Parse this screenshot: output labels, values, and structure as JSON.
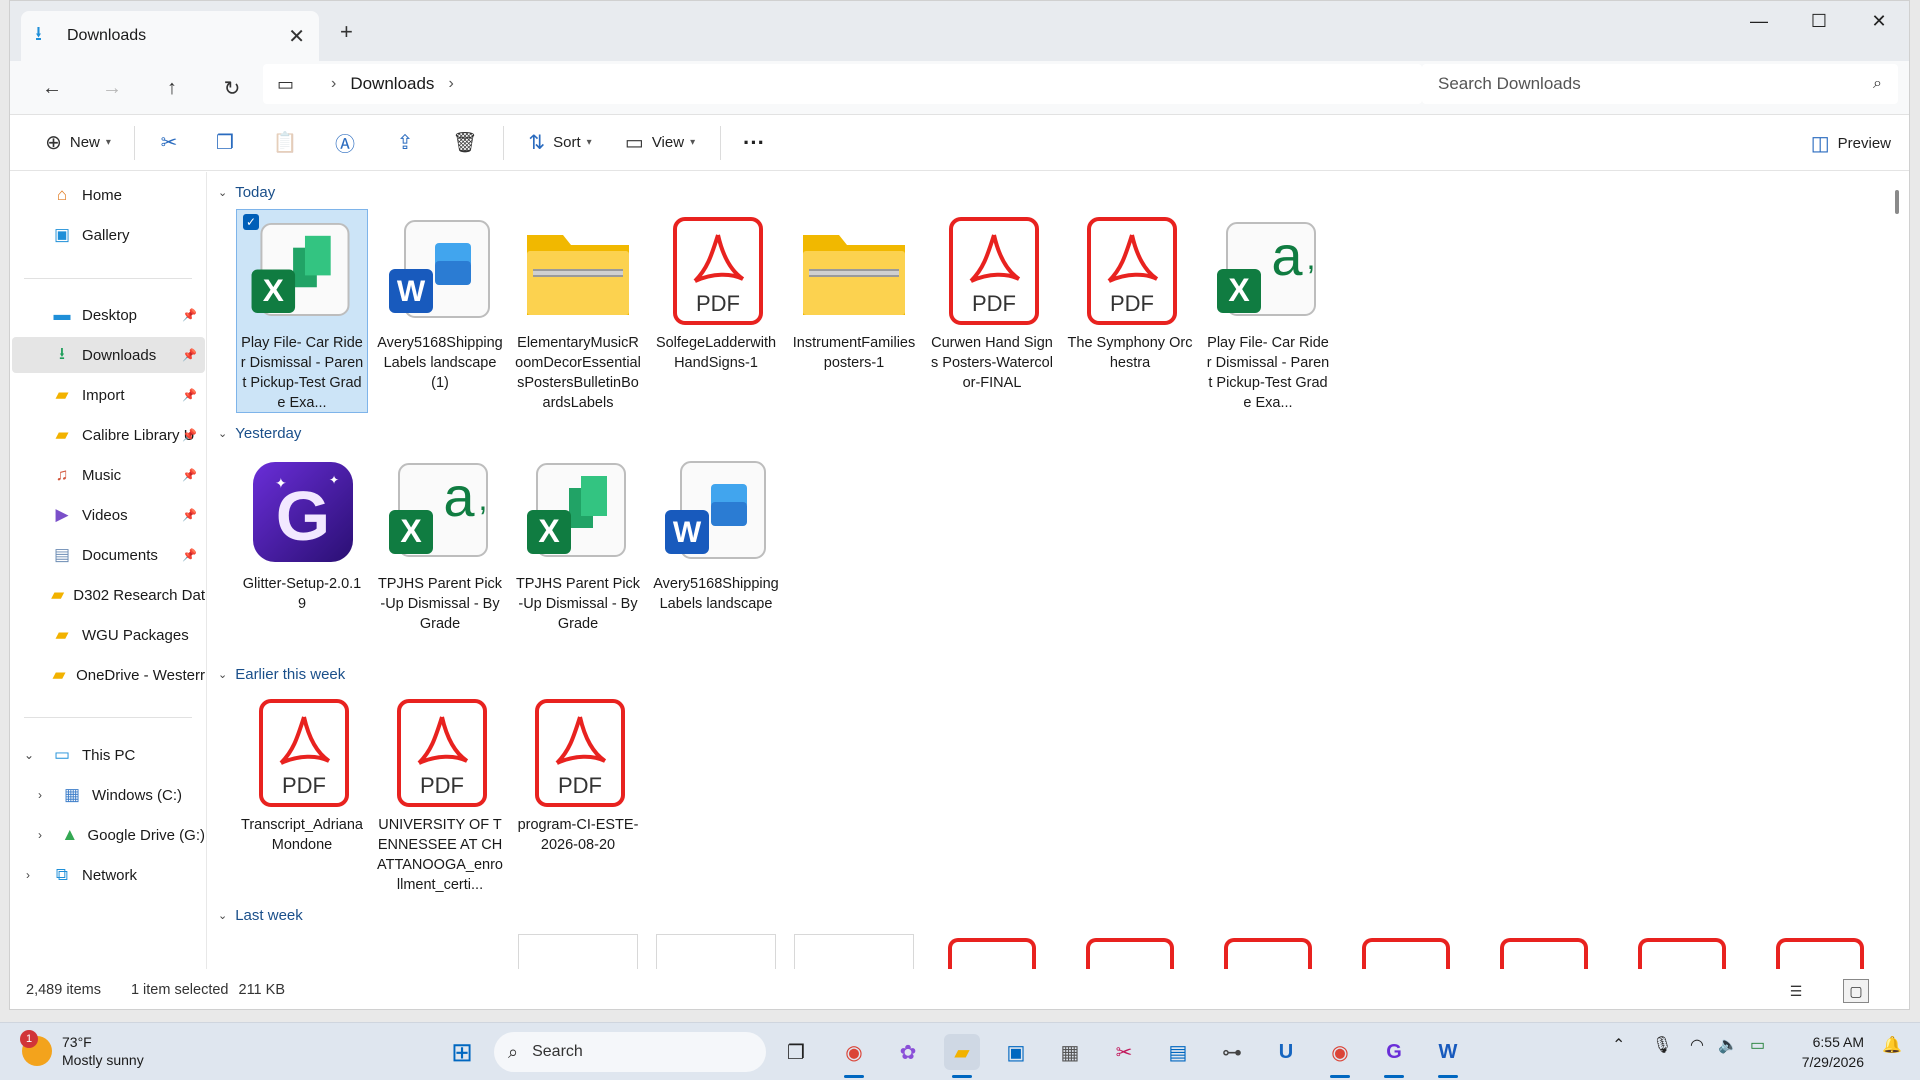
{
  "window": {
    "tab_title": "Downloads",
    "controls": {
      "minimize": "—",
      "maximize": "☐",
      "close": "✕"
    }
  },
  "address": {
    "crumbs": [
      "Downloads"
    ],
    "search_placeholder": "Search Downloads"
  },
  "toolbar": {
    "new_label": "New",
    "sort_label": "Sort",
    "view_label": "View",
    "more_label": "···",
    "preview_label": "Preview"
  },
  "sidebar": {
    "items": [
      {
        "label": "Home",
        "icon": "home-icon"
      },
      {
        "label": "Gallery",
        "icon": "gallery-icon"
      },
      {
        "label": "Desktop",
        "icon": "desktop-icon",
        "pinned": true
      },
      {
        "label": "Downloads",
        "icon": "download-icon",
        "pinned": true,
        "selected": true
      },
      {
        "label": "Import",
        "icon": "folder-icon",
        "pinned": true
      },
      {
        "label": "Calibre Library U",
        "icon": "folder-icon",
        "pinned": true
      },
      {
        "label": "Music",
        "icon": "music-icon",
        "pinned": true
      },
      {
        "label": "Videos",
        "icon": "video-icon",
        "pinned": true
      },
      {
        "label": "Documents",
        "icon": "documents-icon",
        "pinned": true
      },
      {
        "label": "D302 Research Dat",
        "icon": "folder-icon"
      },
      {
        "label": "WGU Packages",
        "icon": "folder-icon"
      },
      {
        "label": "OneDrive - Westerr",
        "icon": "folder-icon"
      },
      {
        "label": "This PC",
        "icon": "pc-icon"
      },
      {
        "label": "Windows (C:)",
        "icon": "drive-icon"
      },
      {
        "label": "Google Drive (G:)",
        "icon": "google-drive-icon"
      },
      {
        "label": "Network",
        "icon": "network-icon"
      }
    ]
  },
  "groups": [
    {
      "title": "Today",
      "files": [
        {
          "name": "Play File- Car Rider Dismissal - Parent Pickup-Test Grade Exa...",
          "type": "excel-xlsx",
          "selected": true
        },
        {
          "name": "Avery5168ShippingLabels landscape (1)",
          "type": "word"
        },
        {
          "name": "ElementaryMusicRoomDecorEssentialsPostersBulletinBoardsLabels",
          "type": "zip"
        },
        {
          "name": "SolfegeLadderwithHandSigns-1",
          "type": "pdf"
        },
        {
          "name": "InstrumentFamiliesposters-1",
          "type": "zip"
        },
        {
          "name": "Curwen Hand Signs Posters-Watercolor-FINAL",
          "type": "pdf"
        },
        {
          "name": "The Symphony Orchestra",
          "type": "pdf"
        },
        {
          "name": "Play File- Car Rider Dismissal - Parent Pickup-Test Grade Exa...",
          "type": "excel-csv"
        }
      ]
    },
    {
      "title": "Yesterday",
      "files": [
        {
          "name": "Glitter-Setup-2.0.19",
          "type": "glitter"
        },
        {
          "name": "TPJHS Parent Pick-Up Dismissal - By Grade",
          "type": "excel-csv"
        },
        {
          "name": "TPJHS Parent Pick-Up Dismissal - By Grade",
          "type": "excel-xlsx"
        },
        {
          "name": "Avery5168ShippingLabels landscape",
          "type": "word"
        }
      ]
    },
    {
      "title": "Earlier this week",
      "files": [
        {
          "name": "Transcript_AdrianaMondone",
          "type": "pdf"
        },
        {
          "name": "UNIVERSITY OF TENNESSEE AT CHATTANOOGA_enrollment_certi...",
          "type": "pdf"
        },
        {
          "name": "program-CI-ESTE-2026-08-20",
          "type": "pdf"
        }
      ]
    },
    {
      "title": "Last week",
      "files": []
    }
  ],
  "status": {
    "item_count": "2,489 items",
    "selection": "1 item selected",
    "size": "211 KB"
  },
  "taskbar": {
    "weather_temp": "73°F",
    "weather_desc": "Mostly sunny",
    "weather_badge": "1",
    "search_label": "Search",
    "time": "6:55 AM",
    "date": "7/29/2026"
  },
  "colors": {
    "accent": "#005fb8",
    "pdf_red": "#e8221f",
    "excel_green": "#107c41",
    "word_blue": "#185abd",
    "folder_yellow": "#f6c343",
    "group_header": "#1a4f8a"
  }
}
